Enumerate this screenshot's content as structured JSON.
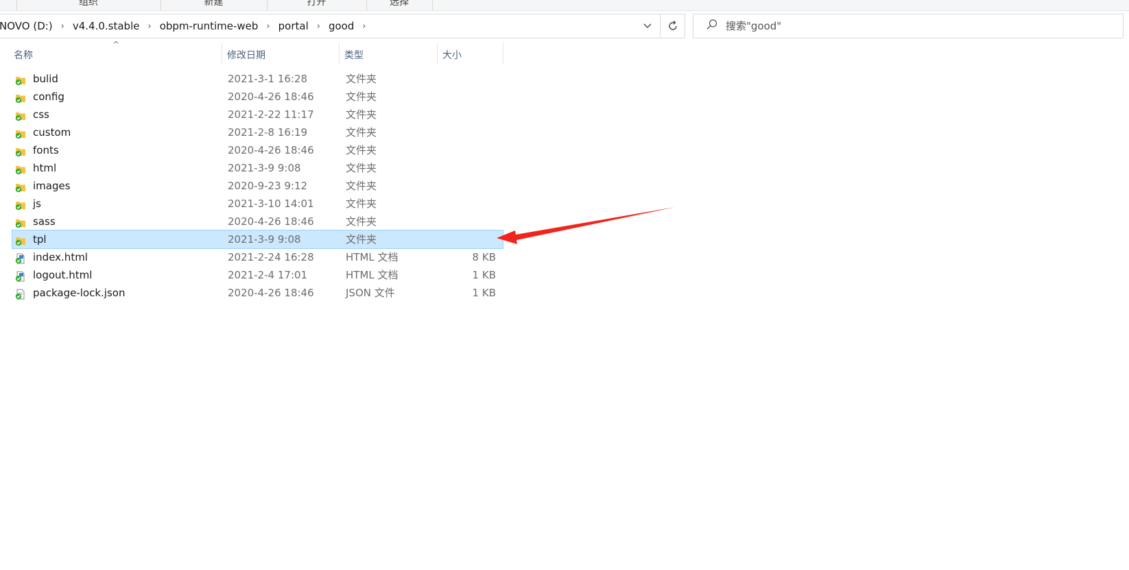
{
  "ribbon": {
    "groups": [
      "组织",
      "新建",
      "打开",
      "选择"
    ]
  },
  "address_bar": {
    "crumbs": [
      "NOVO (D:)",
      "v4.4.0.stable",
      "obpm-runtime-web",
      "portal",
      "good"
    ],
    "separator": "›",
    "dropdown_icon": "chevron-down-icon",
    "refresh_icon": "refresh-icon"
  },
  "search": {
    "icon": "search-icon",
    "placeholder": "搜索\"good\""
  },
  "columns": {
    "name": "名称",
    "date": "修改日期",
    "type": "类型",
    "size": "大小"
  },
  "files": [
    {
      "name": "bulid",
      "date": "2021-3-1 16:28",
      "type": "文件夹",
      "size": "",
      "kind": "folder"
    },
    {
      "name": "config",
      "date": "2020-4-26 18:46",
      "type": "文件夹",
      "size": "",
      "kind": "folder"
    },
    {
      "name": "css",
      "date": "2021-2-22 11:17",
      "type": "文件夹",
      "size": "",
      "kind": "folder"
    },
    {
      "name": "custom",
      "date": "2021-2-8 16:19",
      "type": "文件夹",
      "size": "",
      "kind": "folder"
    },
    {
      "name": "fonts",
      "date": "2020-4-26 18:46",
      "type": "文件夹",
      "size": "",
      "kind": "folder"
    },
    {
      "name": "html",
      "date": "2021-3-9 9:08",
      "type": "文件夹",
      "size": "",
      "kind": "folder"
    },
    {
      "name": "images",
      "date": "2020-9-23 9:12",
      "type": "文件夹",
      "size": "",
      "kind": "folder"
    },
    {
      "name": "js",
      "date": "2021-3-10 14:01",
      "type": "文件夹",
      "size": "",
      "kind": "folder"
    },
    {
      "name": "sass",
      "date": "2020-4-26 18:46",
      "type": "文件夹",
      "size": "",
      "kind": "folder"
    },
    {
      "name": "tpl",
      "date": "2021-3-9 9:08",
      "type": "文件夹",
      "size": "",
      "kind": "folder",
      "selected": true
    },
    {
      "name": "index.html",
      "date": "2021-2-24 16:28",
      "type": "HTML 文档",
      "size": "8 KB",
      "kind": "html"
    },
    {
      "name": "logout.html",
      "date": "2021-2-4 17:01",
      "type": "HTML 文档",
      "size": "1 KB",
      "kind": "html"
    },
    {
      "name": "package-lock.json",
      "date": "2020-4-26 18:46",
      "type": "JSON 文件",
      "size": "1 KB",
      "kind": "file"
    }
  ],
  "colors": {
    "selection_bg": "#cce8ff",
    "selection_border": "#99d1ff",
    "annotation_arrow": "#f0251c",
    "folder_yellow": "#f5c242",
    "sync_badge_green": "#3aa935"
  }
}
